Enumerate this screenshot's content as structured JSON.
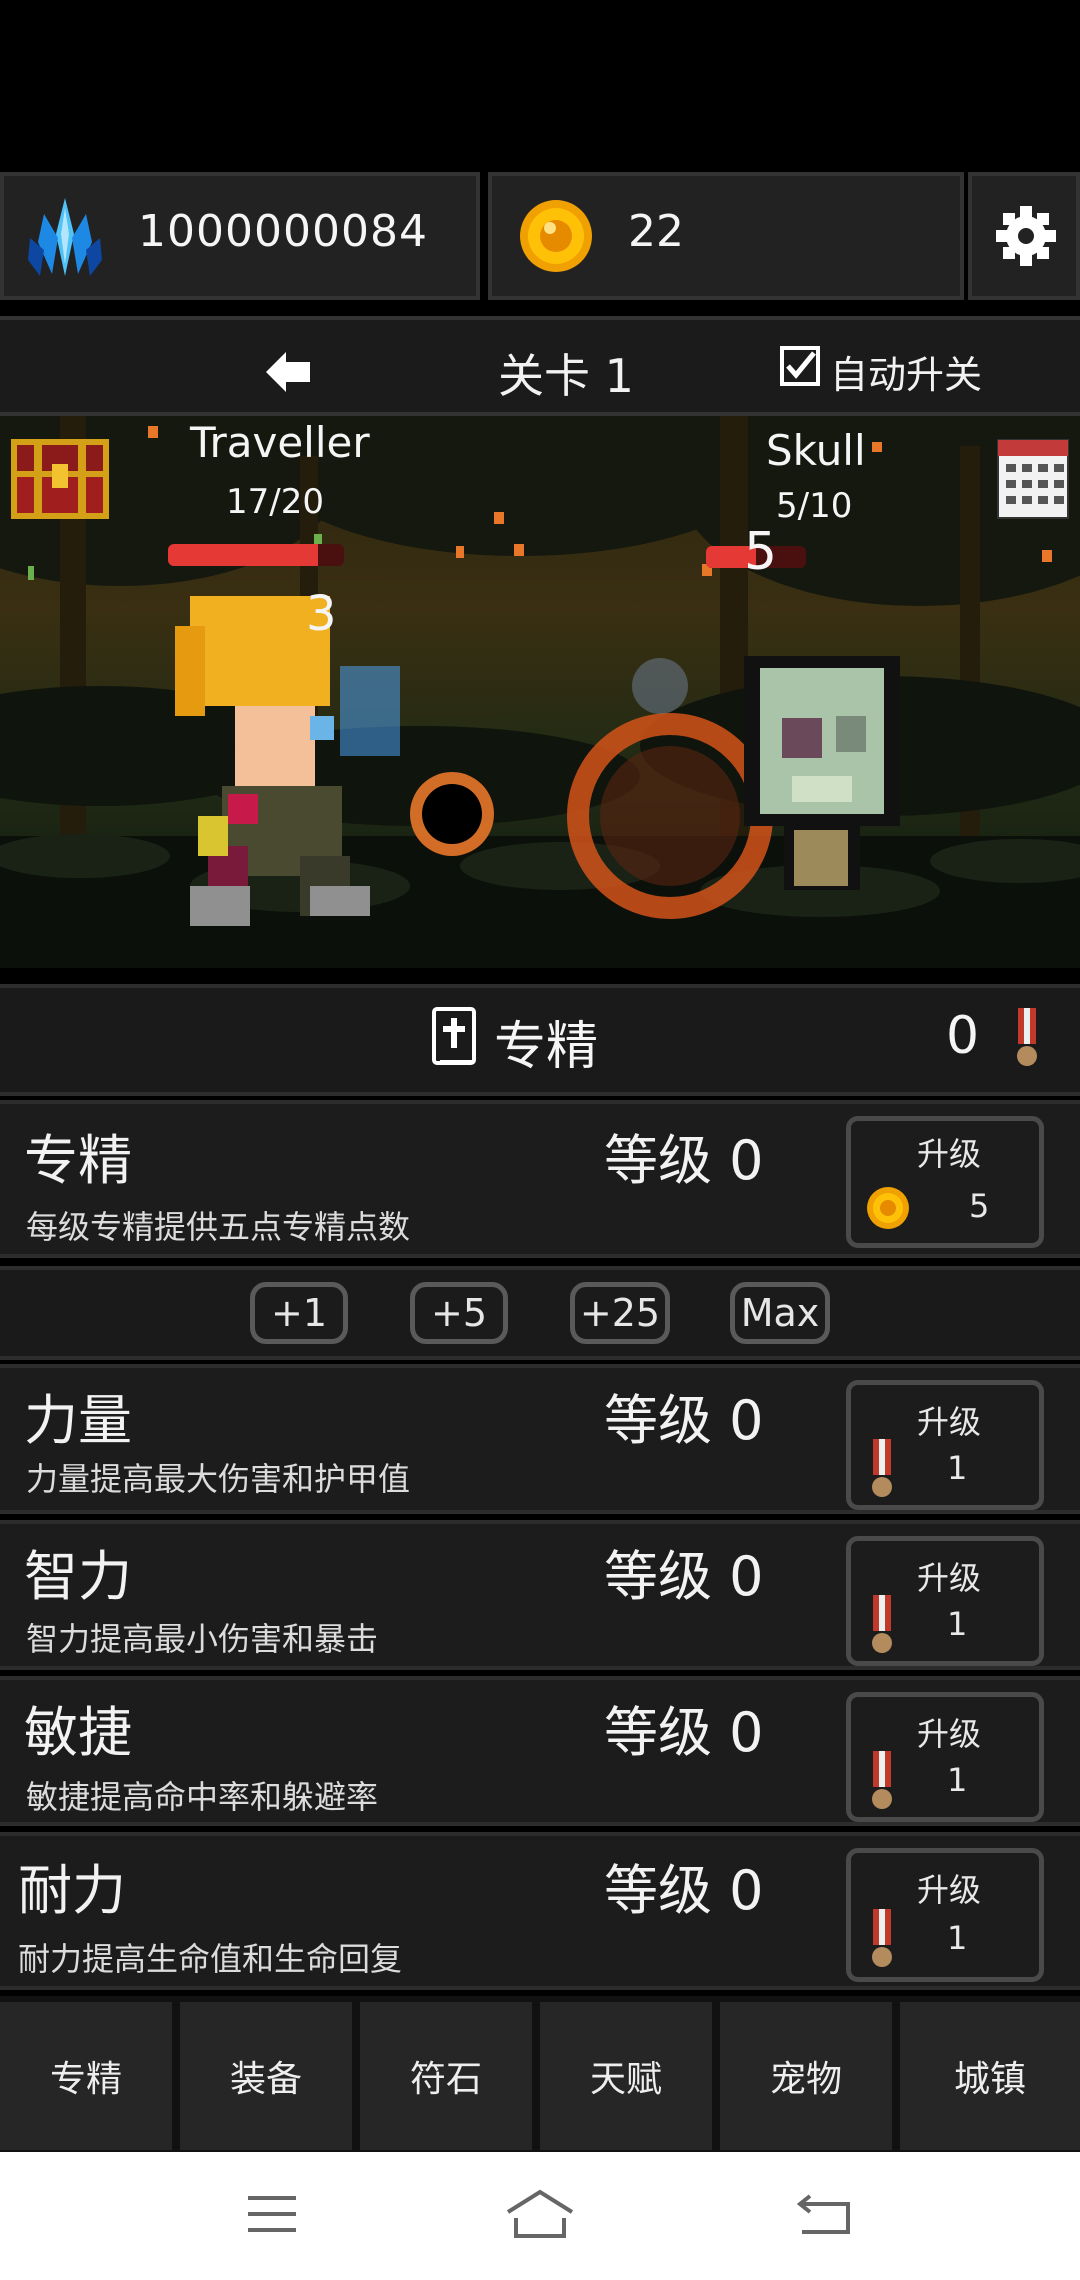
{
  "top_bar": {
    "crystal_count": "1000000084",
    "coin_count": "22",
    "crystal_icon": "crystal-icon",
    "coin_icon": "coin-icon",
    "settings_icon": "gear-icon"
  },
  "stage_bar": {
    "back_icon": "arrow-left-icon",
    "stage_label": "关卡 1",
    "auto_advance_label": "自动升关",
    "auto_advance_checked": true
  },
  "battle": {
    "player": {
      "name": "Traveller",
      "hp": "17/20",
      "hp_fraction": 0.85,
      "damage_popup": "3"
    },
    "enemy": {
      "name": "Skull",
      "hp": "5/10",
      "hp_fraction": 0.5,
      "damage_popup": "5"
    },
    "chest_icon": "treasure-chest-icon",
    "calendar_icon": "calendar-icon"
  },
  "mastery_header": {
    "title": "专精",
    "book_icon": "book-icon",
    "points": "0",
    "medal_icon": "medal-icon"
  },
  "mastery_row": {
    "title": "专精",
    "level_label": "等级 0",
    "description": "每级专精提供五点专精点数",
    "upgrade_label": "升级",
    "cost": "5",
    "cost_icon": "coin-icon"
  },
  "step_buttons": [
    "+1",
    "+5",
    "+25",
    "Max"
  ],
  "stats": [
    {
      "title": "力量",
      "level_label": "等级 0",
      "description": "力量提高最大伤害和护甲值",
      "upgrade_label": "升级",
      "cost": "1"
    },
    {
      "title": "智力",
      "level_label": "等级 0",
      "description": "智力提高最小伤害和暴击",
      "upgrade_label": "升级",
      "cost": "1"
    },
    {
      "title": "敏捷",
      "level_label": "等级 0",
      "description": "敏捷提高命中率和躲避率",
      "upgrade_label": "升级",
      "cost": "1"
    },
    {
      "title": "耐力",
      "level_label": "等级 0",
      "description": "耐力提高生命值和生命回复",
      "upgrade_label": "升级",
      "cost": "1"
    }
  ],
  "tabs": [
    "专精",
    "装备",
    "符石",
    "天赋",
    "宠物",
    "城镇"
  ],
  "system_nav": {
    "menu_icon": "menu-icon",
    "home_icon": "home-icon",
    "back_icon": "back-icon"
  },
  "colors": {
    "hp_bar": "#e53935",
    "accent_gold": "#f5a623",
    "panel": "#1e1e1e"
  }
}
